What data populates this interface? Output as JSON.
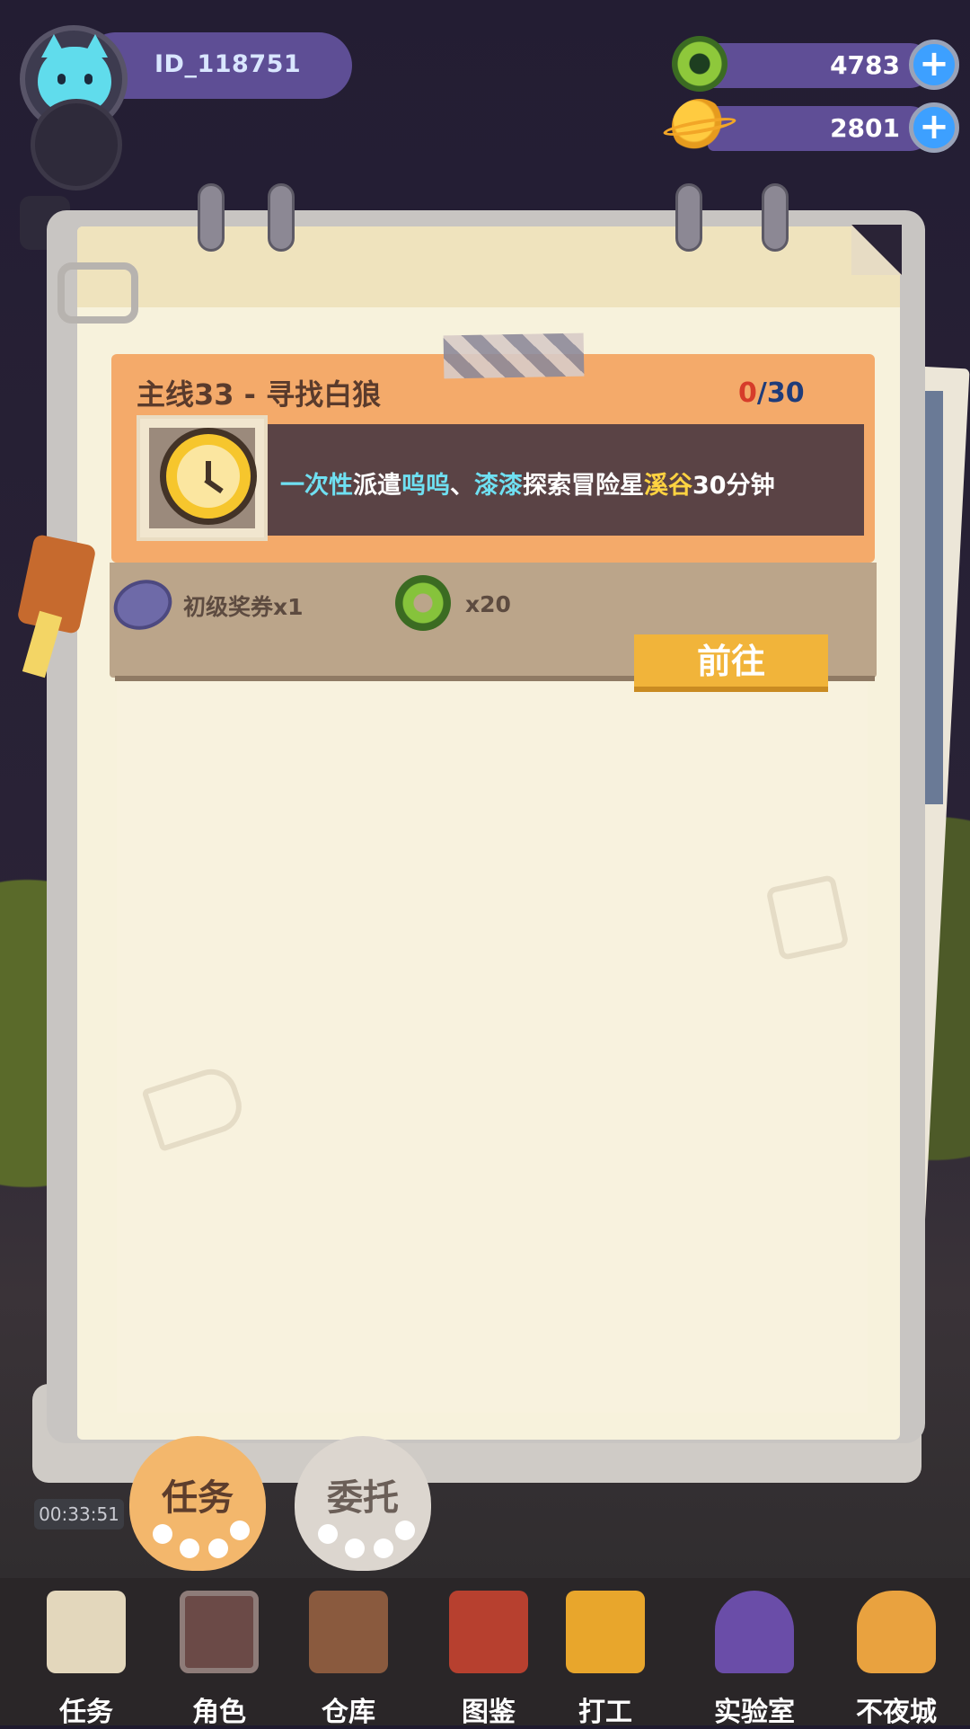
{
  "profile": {
    "id": "ID_118751"
  },
  "currencies": [
    {
      "name": "green-ring",
      "value": "4783",
      "icon": "green-ring-icon"
    },
    {
      "name": "gold-planet",
      "value": "2801",
      "icon": "gold-planet-icon"
    }
  ],
  "task": {
    "title": "主线33 - 寻找白狼",
    "progress_current": "0",
    "progress_total": "/30",
    "desc": {
      "p1": "一次性",
      "p2": "派遣",
      "p3": "呜呜",
      "p4": "、",
      "p5": "漆漆",
      "p6": "探索冒险星",
      "p7": "溪谷",
      "p8": "30分钟"
    },
    "rewards": [
      {
        "label": "初级奖券x1",
        "icon": "ticket-icon"
      },
      {
        "label": "x20",
        "icon": "green-ring-icon"
      }
    ],
    "go_button": "前往"
  },
  "tabs": {
    "active": "任务",
    "inactive": "委托"
  },
  "timer": "00:33:51",
  "nav": [
    "任务",
    "角色",
    "仓库",
    "图鉴",
    "打工",
    "实验室",
    "不夜城"
  ],
  "colors": {
    "accent_orange": "#f4aa6a",
    "button_yellow": "#f1b43a",
    "currency_bar": "#5f4e96"
  }
}
